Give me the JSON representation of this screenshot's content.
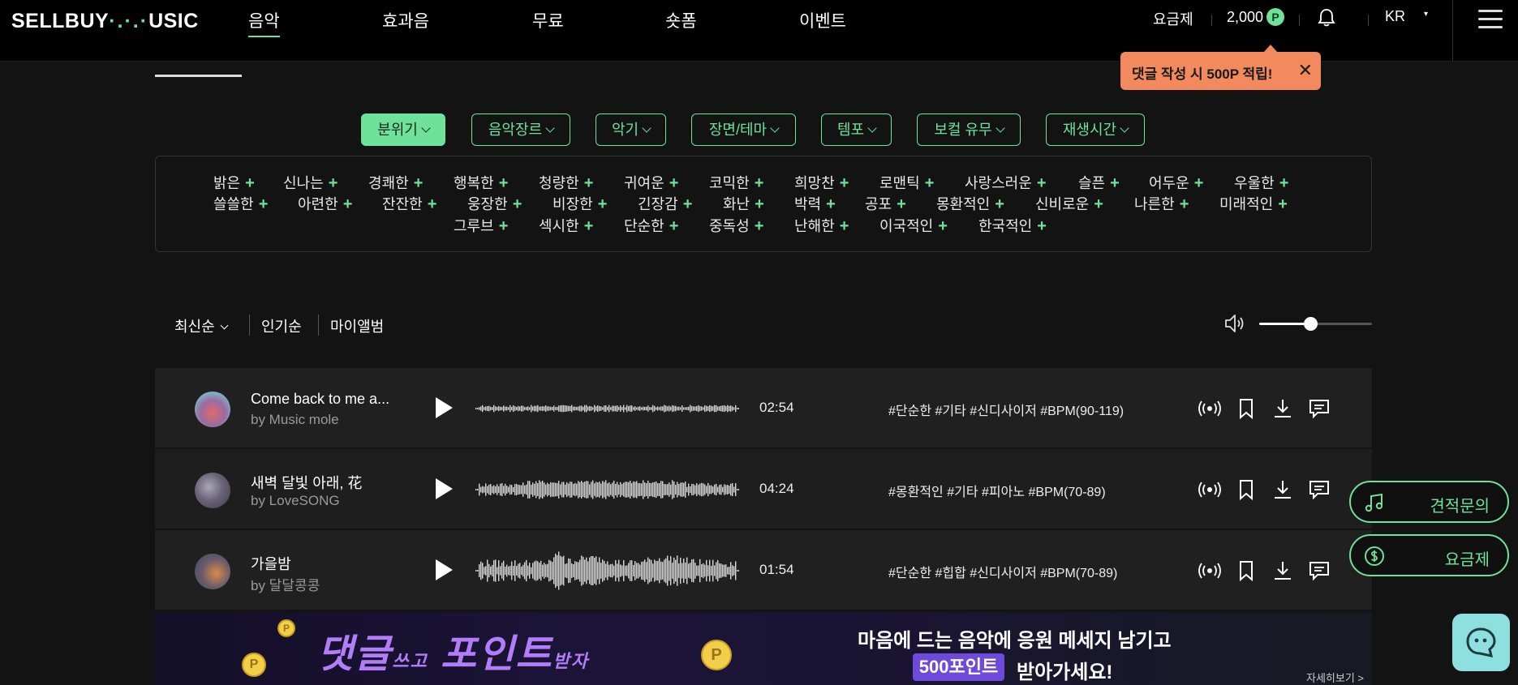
{
  "header": {
    "logo": "SELLBUY",
    "logo_dots": "·.·.·",
    "logo_end": "USIC",
    "nav": [
      "음악",
      "효과음",
      "무료",
      "숏폼",
      "이벤트"
    ],
    "pricing": "요금제",
    "points": "2,000",
    "points_badge": "P",
    "lang": "KR",
    "lang_caret": "▾"
  },
  "tooltip": {
    "text": "댓글 작성 시 500P 적립!",
    "close": "✕"
  },
  "filters": [
    "분위기",
    "음악장르",
    "악기",
    "장면/테마",
    "템포",
    "보컬 유무",
    "재생시간"
  ],
  "mood_tags": [
    [
      "밝은",
      "신나는",
      "경쾌한",
      "행복한",
      "청량한",
      "귀여운",
      "코믹한",
      "희망찬",
      "로맨틱",
      "사랑스러운",
      "슬픈",
      "어두운",
      "우울한"
    ],
    [
      "쓸쓸한",
      "아련한",
      "잔잔한",
      "웅장한",
      "비장한",
      "긴장감",
      "화난",
      "박력",
      "공포",
      "몽환적인",
      "신비로운",
      "나른한",
      "미래적인"
    ],
    [
      "그루브",
      "섹시한",
      "단순한",
      "중독성",
      "난해한",
      "이국적인",
      "한국적인"
    ]
  ],
  "plus": "+",
  "sort": {
    "latest": "최신순",
    "popular": "인기순",
    "my_album": "마이앨범"
  },
  "volume": {
    "level": 0.45
  },
  "tracks": [
    {
      "title": "Come back to me a...",
      "artist": "by Music mole",
      "duration": "02:54",
      "tags": "#단순한 #기타 #신디사이저 #BPM(90-119)"
    },
    {
      "title": "새벽 달빛 아래, 花",
      "artist": "by LoveSONG",
      "duration": "04:24",
      "tags": "#몽환적인 #기타 #피아노 #BPM(70-89)"
    },
    {
      "title": "가을밤",
      "artist": "by 달달콩콩",
      "duration": "01:54",
      "tags": "#단순한 #힙합 #신디사이저 #BPM(70-89)"
    }
  ],
  "side": {
    "quote": "견적문의",
    "pricing": "요금제"
  },
  "banner": {
    "title_a": "댓글",
    "title_small_a": "쓰고",
    "title_b": "포인트",
    "title_small_b": "받자",
    "line1": "마음에 드는 음악에 응원 메세지 남기고",
    "pill": "500포인트",
    "line2": "받아가세요!",
    "more": "자세히보기 >",
    "coin": "P"
  },
  "colors": {
    "accent": "#6ee29b",
    "tooltip": "#f28a5e",
    "banner_purple": "#b27dfa"
  }
}
